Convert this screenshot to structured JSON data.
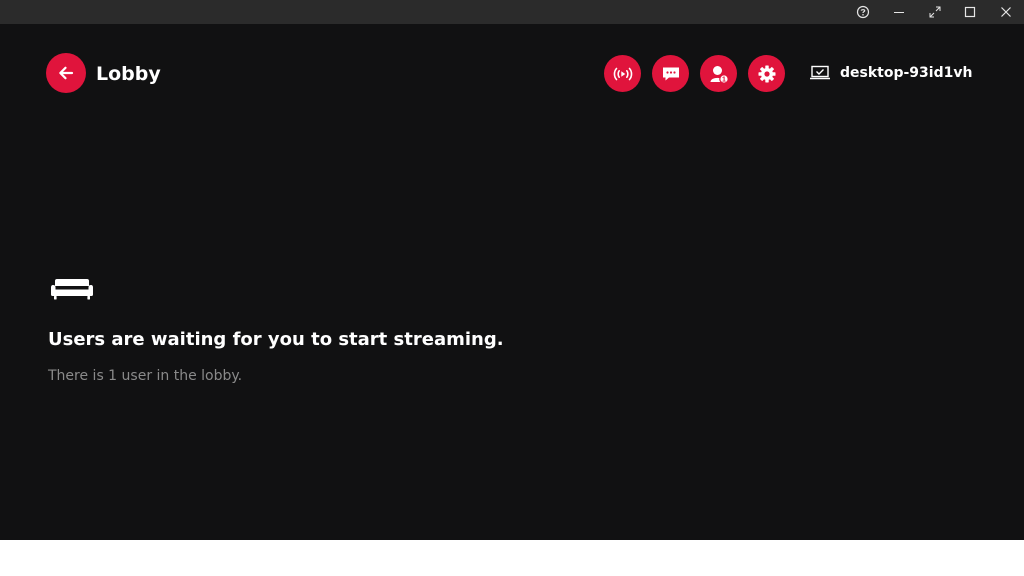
{
  "titlebar": {
    "buttons": [
      "help",
      "minimize",
      "fullscreen",
      "maximize",
      "close"
    ]
  },
  "header": {
    "back_icon": "arrow-left-icon",
    "title": "Lobby",
    "actions": [
      {
        "name": "broadcast",
        "icon": "broadcast-icon"
      },
      {
        "name": "chat",
        "icon": "chat-icon"
      },
      {
        "name": "users",
        "icon": "users-icon",
        "badge": "1"
      },
      {
        "name": "settings",
        "icon": "gear-icon"
      }
    ],
    "device_icon": "laptop-icon",
    "device_name": "desktop-93id1vh"
  },
  "main": {
    "icon": "couch-icon",
    "headline": "Users are waiting for you to start streaming.",
    "subtext": "There is 1 user in the lobby."
  },
  "colors": {
    "accent": "#e0143c",
    "background": "#111112",
    "titlebar": "#2b2b2b",
    "text": "#ffffff",
    "muted_text": "#8a8a8a"
  }
}
